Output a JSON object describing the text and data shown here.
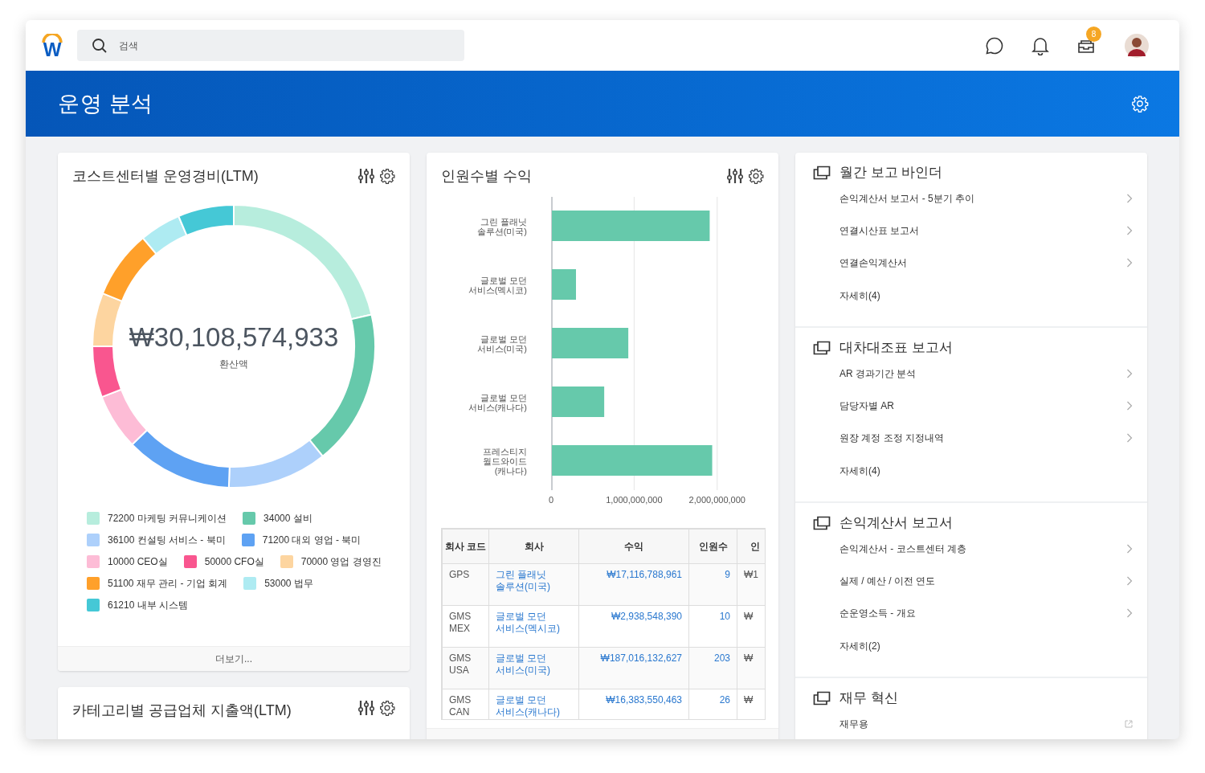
{
  "topbar": {
    "logo": "W",
    "search": {
      "placeholder": "검색"
    },
    "inbox_badge": "8"
  },
  "banner": {
    "title": "운영 분석"
  },
  "cost_center_card": {
    "title": "코스트센터별 운영경비(LTM)",
    "total": "₩30,108,574,933",
    "total_label": "환산액",
    "legend": [
      {
        "label": "72200 마케팅 커뮤니케이션",
        "color": "#b7eddd"
      },
      {
        "label": "34000 설비",
        "color": "#66c9ab"
      },
      {
        "label": "36100 컨설팅 서비스 - 북미",
        "color": "#add0fb"
      },
      {
        "label": "71200 대외 영업 - 북미",
        "color": "#5ea2f3"
      },
      {
        "label": "10000 CEO실",
        "color": "#fdbcd6"
      },
      {
        "label": "50000 CFO실",
        "color": "#f9568f"
      },
      {
        "label": "70000 영업 경영진",
        "color": "#fdd5a0"
      },
      {
        "label": "51100 재무 관리 - 기업 회계",
        "color": "#ffa02a"
      },
      {
        "label": "53000 법무",
        "color": "#aeebf2"
      },
      {
        "label": "61210 내부 시스템",
        "color": "#45c8d6"
      }
    ],
    "footer": "더보기..."
  },
  "supplier_card": {
    "title": "카테고리별 공급업체 지출액(LTM)"
  },
  "headcount_card": {
    "title": "인원수별 수익",
    "chart_data": {
      "type": "bar",
      "orientation": "horizontal",
      "categories": [
        "그린 플래닛 솔루션(미국)",
        "글로벌 모던 서비스(멕시코)",
        "글로벌 모던 서비스(미국)",
        "글로벌 모던 서비스(캐나다)",
        "프레스티지 월드와이드(캐나다)"
      ],
      "series": [
        {
          "color": "#66c9ab",
          "values": [
            1900000000,
            290000000,
            920000000,
            630000000,
            1930000000
          ]
        }
      ],
      "xlim": [
        0,
        2000000000
      ],
      "xticks": [
        {
          "value": 0,
          "label": "0"
        },
        {
          "value": 1000000000,
          "label": "1,000,000,000"
        },
        {
          "value": 2000000000,
          "label": "2,000,000,000"
        }
      ]
    },
    "table": {
      "columns": [
        "회사 코드",
        "회사",
        "수익",
        "인원수",
        "인"
      ],
      "rows": [
        [
          "GPS",
          "그린 플래닛 솔루션(미국)",
          "₩17,116,788,961",
          "9",
          "₩1"
        ],
        [
          "GMS MEX",
          "글로벌 모던 서비스(멕시코)",
          "₩2,938,548,390",
          "10",
          "₩"
        ],
        [
          "GMS USA",
          "글로벌 모던 서비스(미국)",
          "₩187,016,132,627",
          "203",
          "₩"
        ],
        [
          "GMS CAN",
          "글로벌 모던 서비스(캐나다)",
          "₩16,383,550,463",
          "26",
          "₩"
        ]
      ]
    }
  },
  "report_sections": [
    {
      "title": "월간 보고 바인더",
      "items": [
        {
          "label": "손익계산서 보고서 - 5분기 추이",
          "kind": "link"
        },
        {
          "label": "연결시산표 보고서",
          "kind": "link"
        },
        {
          "label": "연결손익계산서",
          "kind": "link"
        }
      ],
      "more": "자세히(4)"
    },
    {
      "title": "대차대조표 보고서",
      "items": [
        {
          "label": "AR 경과기간 분석",
          "kind": "link"
        },
        {
          "label": "담당자별 AR",
          "kind": "link"
        },
        {
          "label": "원장 계정 조정 지정내역",
          "kind": "link"
        }
      ],
      "more": "자세히(4)"
    },
    {
      "title": "손익계산서 보고서",
      "items": [
        {
          "label": "손익계산서 - 코스트센터 계층",
          "kind": "link"
        },
        {
          "label": "실제 / 예산 / 이전 연도",
          "kind": "link"
        },
        {
          "label": "순운영소득 - 개요",
          "kind": "link"
        }
      ],
      "more": "자세히(2)"
    },
    {
      "title": "재무 혁신",
      "items": [
        {
          "label": "재무용",
          "kind": "external"
        }
      ]
    }
  ]
}
